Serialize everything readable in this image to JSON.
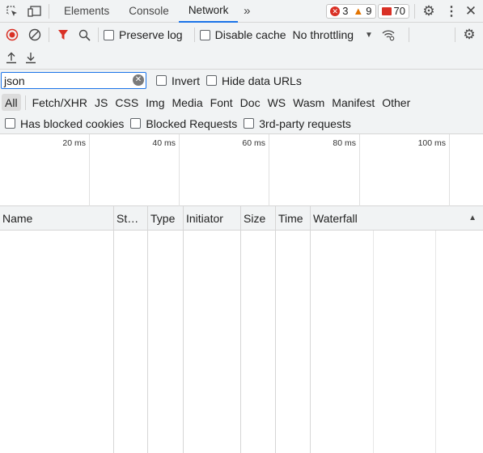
{
  "tabs": [
    {
      "label": "Elements"
    },
    {
      "label": "Console"
    },
    {
      "label": "Network"
    }
  ],
  "badges": {
    "errors": "3",
    "warnings": "9",
    "issues": "70"
  },
  "toolbar": {
    "preserve_log": "Preserve log",
    "disable_cache": "Disable cache",
    "throttling": "No throttling"
  },
  "filter": {
    "value": "json",
    "invert": "Invert",
    "hide_data_urls": "Hide data URLs"
  },
  "types": [
    "All",
    "Fetch/XHR",
    "JS",
    "CSS",
    "Img",
    "Media",
    "Font",
    "Doc",
    "WS",
    "Wasm",
    "Manifest",
    "Other"
  ],
  "blocked": {
    "has_blocked_cookies": "Has blocked cookies",
    "blocked_requests": "Blocked Requests",
    "third_party": "3rd-party requests"
  },
  "timeline_ticks": [
    "20 ms",
    "40 ms",
    "60 ms",
    "80 ms",
    "100 ms"
  ],
  "columns": [
    "Name",
    "St…",
    "Type",
    "Initiator",
    "Size",
    "Time",
    "Waterfall"
  ],
  "colors": {
    "accent": "#1a73e8",
    "error": "#d93025",
    "warning": "#e37400",
    "record": "#d93025"
  },
  "icons": [
    "inspect-icon",
    "device-toolbar-icon",
    "more-tabs-icon",
    "settings-icon",
    "kebab-menu-icon",
    "close-icon",
    "record-icon",
    "clear-icon",
    "filter-icon",
    "search-icon",
    "network-conditions-icon",
    "upload-icon",
    "download-icon",
    "sort-up-icon"
  ]
}
